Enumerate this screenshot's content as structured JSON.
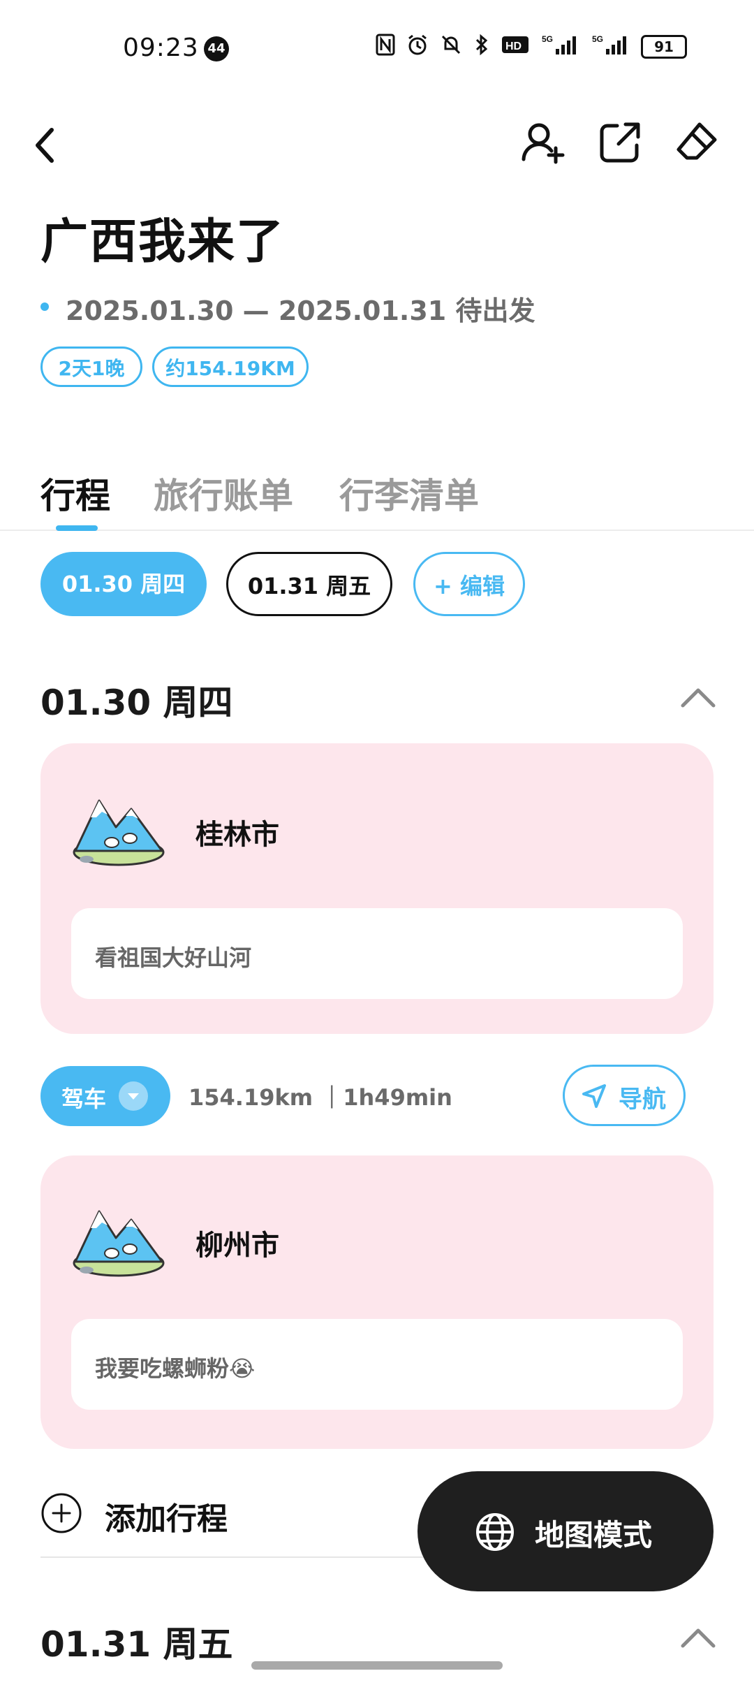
{
  "status_bar": {
    "time": "09:23",
    "notification_count": "44",
    "battery": "91",
    "icons": [
      "nfc-icon",
      "alarm-icon",
      "mute-icon",
      "bluetooth-icon",
      "hd-icon",
      "signal-5g-icon",
      "signal-5g-icon"
    ]
  },
  "header": {
    "title": "广西我来了",
    "date_range": "2025.01.30 — 2025.01.31 待出发",
    "tags": [
      "2天1晚",
      "约154.19KM"
    ]
  },
  "tabs": [
    {
      "label": "行程",
      "active": true
    },
    {
      "label": "旅行账单",
      "active": false
    },
    {
      "label": "行李清单",
      "active": false
    }
  ],
  "day_chips": {
    "day1": "01.30 周四",
    "day2": "01.31 周五",
    "edit": "+ 编辑"
  },
  "day1": {
    "heading": "01.30 周四",
    "stops": [
      {
        "city": "桂林市",
        "note": "看祖国大好山河"
      },
      {
        "city": "柳州市",
        "note": "我要吃螺蛳粉😭"
      }
    ],
    "transport": {
      "mode": "驾车",
      "info": "154.19km ｜1h49min",
      "nav_label": "导航"
    }
  },
  "add_itinerary": "添加行程",
  "map_mode": "地图模式",
  "day2": {
    "heading": "01.31 周五"
  },
  "colors": {
    "accent": "#49b9f2",
    "card_bg": "#fde6ec",
    "dark_button": "#1f1f1f"
  }
}
